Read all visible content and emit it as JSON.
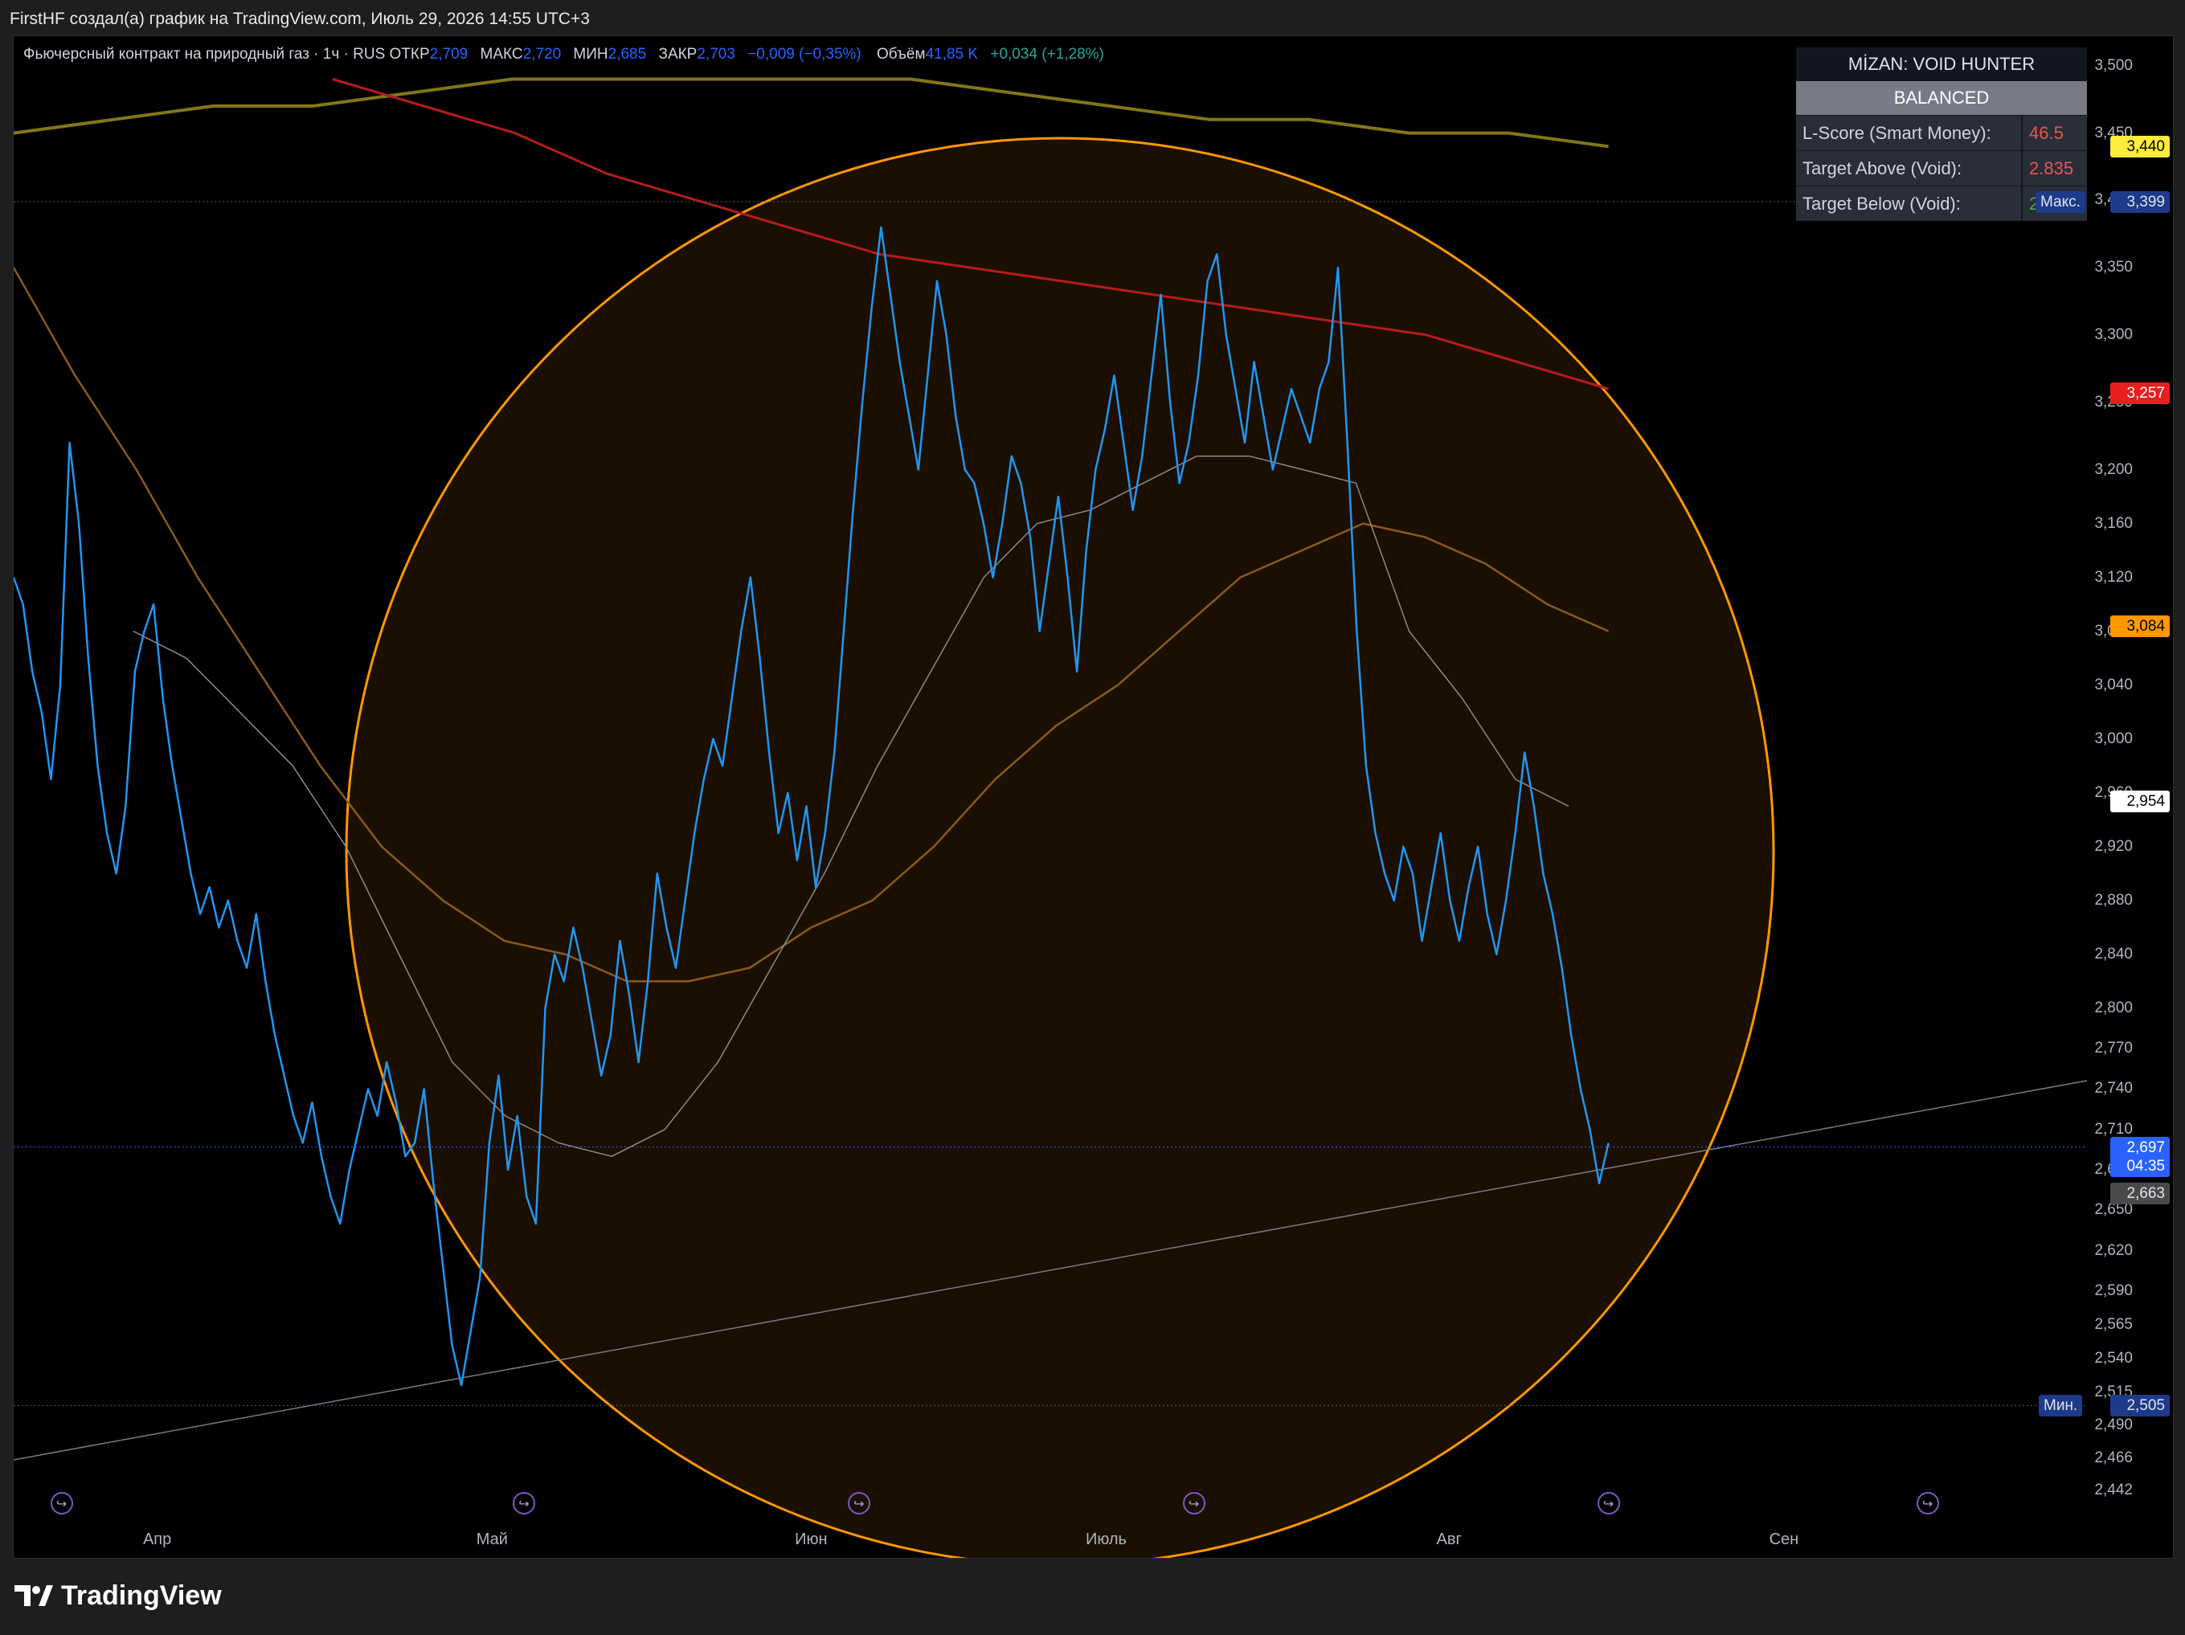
{
  "caption": "FirstHF создал(а) график на TradingView.com, Июль 29, 2026 14:55 UTC+3",
  "legend": {
    "symbol": "Фьючерсный контракт на природный газ · 1ч · RUS",
    "open_label": "ОТКР",
    "open": "2,709",
    "high_label": "МАКС",
    "high": "2,720",
    "low_label": "МИН",
    "low": "2,685",
    "close_label": "ЗАКР",
    "close": "2,703",
    "change": "−0,009 (−0,35%)",
    "volume_label": "Объём",
    "volume": "41,85 K",
    "volume_change": "+0,034 (+1,28%)"
  },
  "indicator_table": {
    "title": "MİZAN: VOID HUNTER",
    "status": "BALANCED",
    "rows": [
      {
        "label": "L-Score (Smart Money):",
        "value": "46.5",
        "color": "#ef5350"
      },
      {
        "label": "Target Above (Void):",
        "value": "2.835",
        "color": "#ef5350"
      },
      {
        "label": "Target Below (Void):",
        "value": "2.669",
        "color": "#4caf50"
      }
    ]
  },
  "price_tags": [
    {
      "id": "tag-3440",
      "text": "3,440",
      "value": 3.44,
      "bg": "#ffeb3b",
      "fg": "#000000"
    },
    {
      "id": "tag-3399",
      "text": "3,399",
      "value": 3.399,
      "bg": "#1e3a8a",
      "fg": "#e0e3eb"
    },
    {
      "id": "tag-3257",
      "text": "3,257",
      "value": 3.257,
      "bg": "#e91e1e",
      "fg": "#ffffff"
    },
    {
      "id": "tag-3084",
      "text": "3,084",
      "value": 3.084,
      "bg": "#ff9800",
      "fg": "#000000"
    },
    {
      "id": "tag-2954",
      "text": "2,954",
      "value": 2.954,
      "bg": "#ffffff",
      "fg": "#000000"
    },
    {
      "id": "tag-2697",
      "text": "2,697",
      "value": 2.697,
      "bg": "#2962ff",
      "fg": "#ffffff"
    },
    {
      "id": "tag-2663",
      "text": "2,663",
      "value": 2.663,
      "bg": "#4a4a4a",
      "fg": "#e0e3eb"
    },
    {
      "id": "tag-2505",
      "text": "2,505",
      "value": 2.505,
      "bg": "#1e3a8a",
      "fg": "#e0e3eb"
    }
  ],
  "countdown": "04:35",
  "max_label": "Макс.",
  "min_label": "Мин.",
  "brand": "TradingView",
  "chart_data": {
    "type": "line",
    "title": "Фьючерсный контракт на природный газ · 1ч · RUS",
    "y_ticks": [
      "3,500",
      "3,450",
      "3,400",
      "3,350",
      "3,300",
      "3,250",
      "3,200",
      "3,160",
      "3,120",
      "3,080",
      "3,040",
      "3,000",
      "2,960",
      "2,920",
      "2,880",
      "2,840",
      "2,800",
      "2,770",
      "2,740",
      "2,710",
      "2,680",
      "2,650",
      "2,620",
      "2,590",
      "2,565",
      "2,540",
      "2,515",
      "2,490",
      "2,466",
      "2,442"
    ],
    "y_tick_values": [
      3.5,
      3.45,
      3.4,
      3.35,
      3.3,
      3.25,
      3.2,
      3.16,
      3.12,
      3.08,
      3.04,
      3.0,
      2.96,
      2.92,
      2.88,
      2.84,
      2.8,
      2.77,
      2.74,
      2.71,
      2.68,
      2.65,
      2.62,
      2.59,
      2.565,
      2.54,
      2.515,
      2.49,
      2.466,
      2.442
    ],
    "x_ticks": [
      "Апр",
      "Май",
      "Июн",
      "Июль",
      "Авг",
      "Сен"
    ],
    "x_tick_index": [
      18,
      60,
      100,
      137,
      180,
      222
    ],
    "ylim": [
      2.43,
      3.51
    ],
    "grid": false,
    "series": [
      {
        "values": [
          3.12,
          3.1,
          3.05,
          3.02,
          2.97,
          3.04,
          3.22,
          3.16,
          3.06,
          2.98,
          2.93,
          2.9,
          2.95,
          3.05,
          3.08,
          3.1,
          3.03,
          2.98,
          2.94,
          2.9,
          2.87,
          2.89,
          2.86,
          2.88,
          2.85,
          2.83,
          2.87,
          2.82,
          2.78,
          2.75,
          2.72,
          2.7,
          2.73,
          2.69,
          2.66,
          2.64,
          2.68,
          2.71,
          2.74,
          2.72,
          2.76,
          2.73,
          2.69,
          2.7,
          2.74,
          2.67,
          2.61,
          2.55,
          2.52,
          2.56,
          2.6,
          2.7,
          2.75,
          2.68,
          2.72,
          2.66,
          2.64,
          2.8,
          2.84,
          2.82,
          2.86,
          2.83,
          2.79,
          2.75,
          2.78,
          2.85,
          2.81,
          2.76,
          2.82,
          2.9,
          2.86,
          2.83,
          2.88,
          2.93,
          2.97,
          3.0,
          2.98,
          3.03,
          3.08,
          3.12,
          3.06,
          2.99,
          2.93,
          2.96,
          2.91,
          2.95,
          2.89,
          2.93,
          2.99,
          3.08,
          3.17,
          3.25,
          3.32,
          3.38,
          3.33,
          3.28,
          3.24,
          3.2,
          3.27,
          3.34,
          3.3,
          3.24,
          3.2,
          3.19,
          3.16,
          3.12,
          3.16,
          3.21,
          3.19,
          3.15,
          3.08,
          3.13,
          3.18,
          3.12,
          3.05,
          3.14,
          3.2,
          3.23,
          3.27,
          3.22,
          3.17,
          3.21,
          3.27,
          3.33,
          3.25,
          3.19,
          3.22,
          3.27,
          3.34,
          3.36,
          3.3,
          3.26,
          3.22,
          3.28,
          3.24,
          3.2,
          3.23,
          3.26,
          3.24,
          3.22,
          3.26,
          3.28,
          3.35,
          3.22,
          3.08,
          2.98,
          2.93,
          2.9,
          2.88,
          2.92,
          2.9,
          2.85,
          2.89,
          2.93,
          2.88,
          2.85,
          2.89,
          2.92,
          2.87,
          2.84,
          2.88,
          2.93,
          2.99,
          2.95,
          2.9,
          2.87,
          2.83,
          2.78,
          2.74,
          2.71,
          2.67,
          2.7
        ],
        "color": "#2196f3"
      },
      {
        "values": [
          3.45,
          3.46,
          3.47,
          3.47,
          3.48,
          3.49,
          3.49,
          3.49,
          3.49,
          3.49,
          3.48,
          3.47,
          3.46,
          3.46,
          3.45,
          3.45,
          3.44
        ],
        "color": "#827717"
      },
      {
        "values": [
          3.49,
          3.47,
          3.45,
          3.42,
          3.4,
          3.38,
          3.36,
          3.35,
          3.34,
          3.33,
          3.32,
          3.31,
          3.3,
          3.28,
          3.26
        ],
        "color": "#b71c1c"
      },
      {
        "values": [
          3.35,
          3.27,
          3.2,
          3.12,
          3.05,
          2.98,
          2.92,
          2.88,
          2.85,
          2.84,
          2.82,
          2.82,
          2.83,
          2.86,
          2.88,
          2.92,
          2.97,
          3.01,
          3.04,
          3.08,
          3.12,
          3.14,
          3.16,
          3.15,
          3.13,
          3.1,
          3.08
        ],
        "color": "#8d5a1a"
      },
      {
        "values": [
          3.08,
          3.06,
          3.02,
          2.98,
          2.92,
          2.84,
          2.76,
          2.72,
          2.7,
          2.69,
          2.71,
          2.76,
          2.83,
          2.9,
          2.98,
          3.05,
          3.12,
          3.16,
          3.17,
          3.19,
          3.21,
          3.21,
          3.2,
          3.19,
          3.08,
          3.03,
          2.97,
          2.95
        ],
        "color": "#8a8a8a"
      }
    ]
  }
}
